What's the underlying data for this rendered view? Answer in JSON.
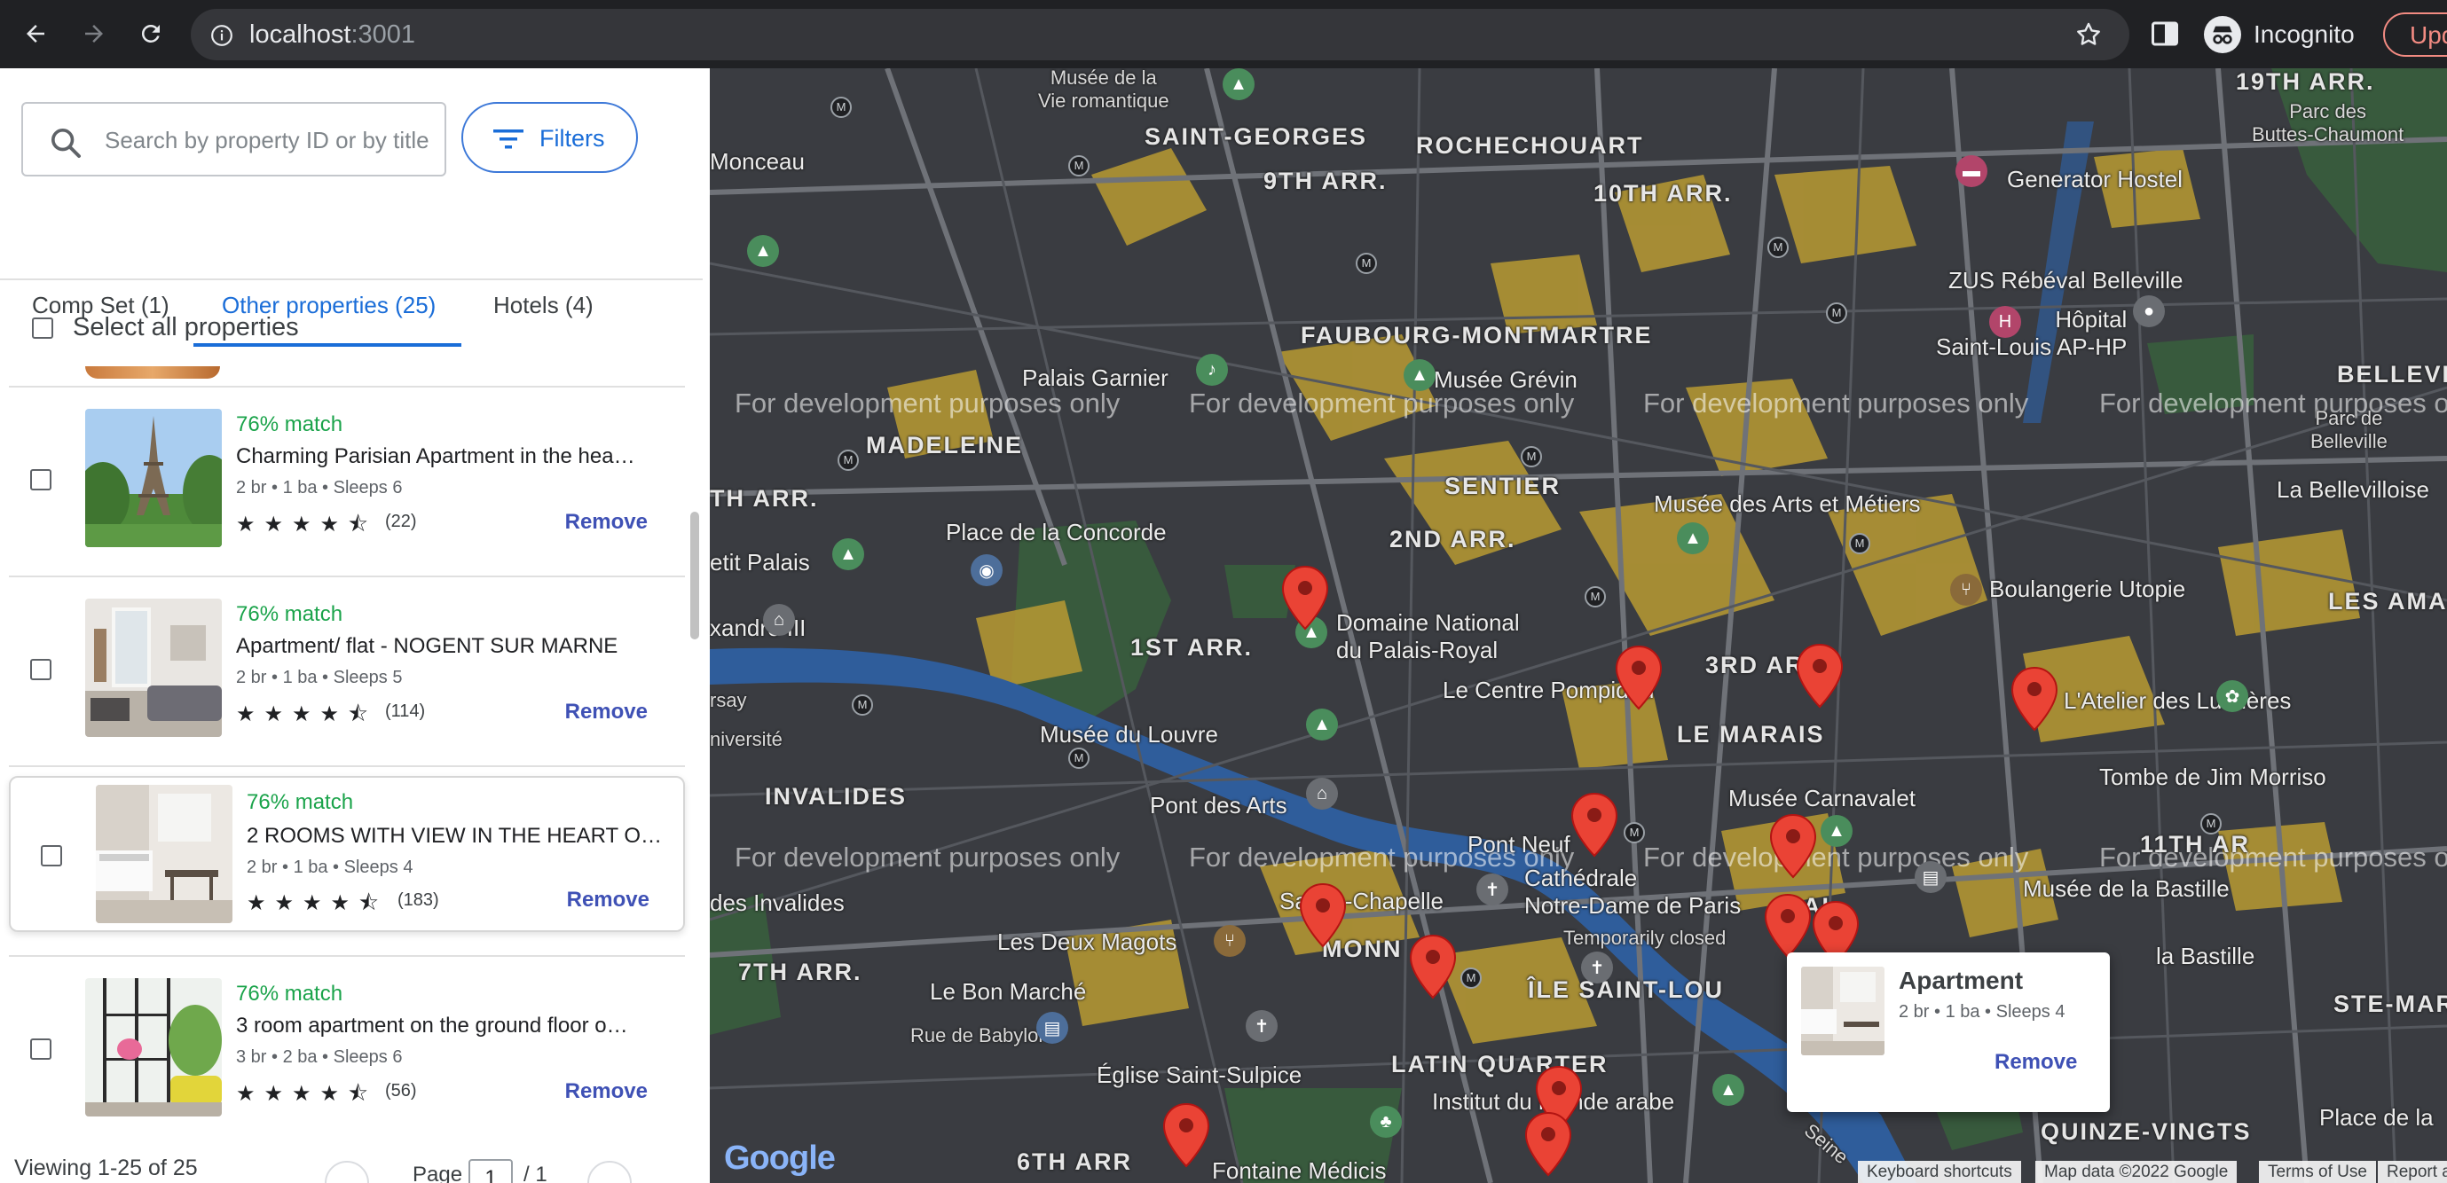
{
  "browser": {
    "url_host": "localhost",
    "url_port": ":3001",
    "profile_label": "Incognito",
    "update_label": "Upd"
  },
  "search": {
    "placeholder": "Search by property ID or by title",
    "filters_label": "Filters"
  },
  "tabs": [
    {
      "label": "Comp Set (1)",
      "active": false
    },
    {
      "label": "Other properties (25)",
      "active": true
    },
    {
      "label": "Hotels (4)",
      "active": false
    }
  ],
  "select_all_label": "Select all properties",
  "properties": [
    {
      "match": "76% match",
      "title": "Charming Parisian Apartment in the hea…",
      "meta": "2 br • 1 ba • Sleeps 6",
      "stars": "★★★★⯪",
      "reviews": "(22)",
      "remove": "Remove",
      "image": "eiffel-tower-photo"
    },
    {
      "match": "76% match",
      "title": "Apartment/ flat - NOGENT SUR MARNE",
      "meta": "2 br • 1 ba • Sleeps 5",
      "stars": "★★★★⯪",
      "reviews": "(114)",
      "remove": "Remove",
      "image": "living-room-photo"
    },
    {
      "match": "76% match",
      "title": "2 ROOMS WITH VIEW IN THE HEART OF…",
      "meta": "2 br • 1 ba • Sleeps 4",
      "stars": "★★★★⯪",
      "reviews": "(183)",
      "remove": "Remove",
      "image": "kitchen-photo",
      "highlighted": true
    },
    {
      "match": "76% match",
      "title": "3 room apartment on the ground floor o…",
      "meta": "3 br • 2 ba • Sleeps 6",
      "stars": "★★★★⯪",
      "reviews": "(56)",
      "remove": "Remove",
      "image": "sunroom-photo"
    }
  ],
  "pagination": {
    "viewing": "Viewing 1-25 of 25",
    "page_label": "Page",
    "page_value": "1",
    "page_of": "/ 1"
  },
  "map": {
    "watermark": "For development purposes only",
    "labels": {
      "musee_vie": "Musée de la\nVie romantique",
      "saint_georges": "SAINT-GEORGES",
      "rochechouart": "ROCHECHOUART",
      "monceau": "Monceau",
      "arr9": "9TH ARR.",
      "arr10": "10TH ARR.",
      "arr19": "19TH ARR.",
      "buttes": "Parc des\nButtes-Chaumont",
      "generator": "Generator Hostel",
      "zus": "ZUS Rébéval Belleville",
      "hopital": "Hôpital\nSaint-Louis AP-HP",
      "faubourg": "FAUBOURG-MONTMARTRE",
      "palais_garnier": "Palais Garnier",
      "musee_grevin": "Musée Grévin",
      "belleville": "BELLEVILL",
      "parc_belleville": "Parc de\nBelleville",
      "madeleine": "MADELEINE",
      "sentier": "SENTIER",
      "arts_metiers": "Musée des Arts et Métiers",
      "la_bellevilloise": "La Bellevilloise",
      "arr8": "TH ARR.",
      "concorde": "Place de la Concorde",
      "arr2": "2ND ARR.",
      "petit_palais": "etit Palais",
      "boulangerie": "Boulangerie Utopie",
      "amand": "LES AMAND",
      "alexandre": "xandre III",
      "domaine": "Domaine National\ndu Palais-Royal",
      "arr1": "1ST ARR.",
      "arr3": "3RD AR",
      "pompidou": "Le Centre Pompidou",
      "marais": "LE MARAIS",
      "atelier": "L'Atelier des Lumières",
      "rsay": "rsay",
      "universite": "niversité",
      "louvre": "Musée du Louvre",
      "tombe": "Tombe de Jim Morriso",
      "invalides_district": "INVALIDES",
      "pont_arts": "Pont des Arts",
      "carnavalet": "Musée Carnavalet",
      "pont_neuf": "Pont Neuf",
      "arr11": "11TH AR",
      "des_invalides": "des Invalides",
      "sainte_chapelle": "Sainte-Chapelle",
      "cathedrale": "Cathédrale\nNotre-Dame de Paris",
      "temp_closed": "Temporarily closed",
      "bastille_museum": "Musée de la Bastille",
      "deux_magots": "Les Deux Magots",
      "monnaie": "MONN",
      "arr7": "7TH ARR.",
      "bastille": "la Bastille",
      "bon_marche": "Le Bon Marché",
      "ile_saint_louis": "ÎLE SAINT-LOU",
      "ste_mar": "STE-MAR",
      "babylone": "Rue de Babylone",
      "eglise": "Église Saint-Sulpice",
      "latin": "LATIN QUARTER",
      "monde_arabe": "Institut du monde arabe",
      "quinze": "QUINZE-VINGTS",
      "place_de_la": "Place de la",
      "arr6": "6TH ARR",
      "medicis": "Fontaine Médicis",
      "seine": "Seine",
      "qu": "QU",
      "sai": "SAI"
    },
    "popup": {
      "title": "Apartment",
      "meta": "2 br • 1 ba • Sleeps 4",
      "remove": "Remove"
    },
    "attribution": {
      "shortcuts": "Keyboard shortcuts",
      "data": "Map data ©2022 Google",
      "terms": "Terms of Use",
      "report": "Report a"
    },
    "google_logo": "Google",
    "pin_color": "#ea4335"
  }
}
